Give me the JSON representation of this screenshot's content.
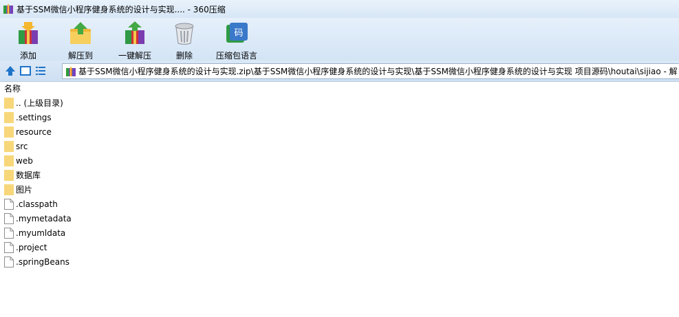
{
  "window": {
    "title": "基于SSM微信小程序健身系统的设计与实现.... - 360压缩"
  },
  "toolbar": {
    "buttons": [
      {
        "label": "添加",
        "icon": "add-archive-icon"
      },
      {
        "label": "解压到",
        "icon": "extract-to-icon"
      },
      {
        "label": "一键解压",
        "icon": "one-click-extract-icon"
      },
      {
        "label": "删除",
        "icon": "trash-icon"
      },
      {
        "label": "压缩包语言",
        "icon": "archive-language-icon"
      }
    ]
  },
  "address": {
    "path": "基于SSM微信小程序健身系统的设计与实现.zip\\基于SSM微信小程序健身系统的设计与实现\\基于SSM微信小程序健身系统的设计与实现 项目源码\\houtai\\sijiao - 解"
  },
  "columns": {
    "name": "名称"
  },
  "files": [
    {
      "name": ".. (上级目录)",
      "type": "folder"
    },
    {
      "name": ".settings",
      "type": "folder"
    },
    {
      "name": "resource",
      "type": "folder"
    },
    {
      "name": "src",
      "type": "folder"
    },
    {
      "name": "web",
      "type": "folder"
    },
    {
      "name": "数据库",
      "type": "folder"
    },
    {
      "name": "图片",
      "type": "folder"
    },
    {
      "name": ".classpath",
      "type": "file"
    },
    {
      "name": ".mymetadata",
      "type": "file"
    },
    {
      "name": ".myumldata",
      "type": "file"
    },
    {
      "name": ".project",
      "type": "file"
    },
    {
      "name": ".springBeans",
      "type": "file"
    }
  ],
  "colors": {
    "folder": "#f7d77a",
    "accent": "#1e73c8"
  }
}
